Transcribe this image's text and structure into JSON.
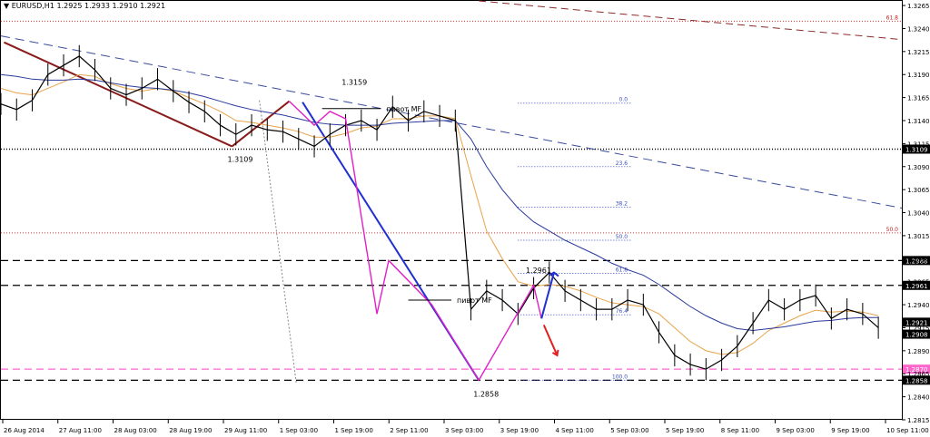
{
  "header": {
    "symbol_title": "EURUSD,H1",
    "ohlc": "1.2925 1.2933 1.2910 1.2921"
  },
  "chart_data": {
    "type": "line",
    "title": "EURUSD,H1 1.2925 1.2933 1.2910 1.2921",
    "xlabel": "",
    "ylabel": "",
    "ylim": [
      1.2815,
      1.327
    ],
    "y_ticks": [
      "1.3265",
      "1.3240",
      "1.3215",
      "1.3190",
      "1.3165",
      "1.3140",
      "1.3115",
      "1.3090",
      "1.3065",
      "1.3040",
      "1.3015",
      "1.2990",
      "1.2965",
      "1.2940",
      "1.2915",
      "1.2890",
      "1.2865",
      "1.2840",
      "1.2815"
    ],
    "x_tick_labels": [
      "26 Aug 2014",
      "27 Aug 11:00",
      "28 Aug 03:00",
      "28 Aug 19:00",
      "29 Aug 11:00",
      "1 Sep 03:00",
      "1 Sep 19:00",
      "2 Sep 11:00",
      "3 Sep 03:00",
      "3 Sep 19:00",
      "4 Sep 11:00",
      "5 Sep 03:00",
      "5 Sep 19:00",
      "8 Sep 11:00",
      "9 Sep 03:00",
      "9 Sep 19:00",
      "10 Sep 11:00"
    ],
    "x_range": [
      0,
      115
    ],
    "price": {
      "name": "",
      "x": [
        0,
        2,
        4,
        6,
        8,
        10,
        12,
        14,
        16,
        18,
        20,
        22,
        24,
        26,
        28,
        30,
        32,
        34,
        36,
        38,
        40,
        42,
        44,
        46,
        48,
        50,
        52,
        54,
        56,
        58,
        60,
        62,
        64,
        66,
        68,
        70,
        72,
        74,
        76,
        78,
        80,
        82,
        84,
        86,
        88,
        90,
        92,
        94,
        96,
        98,
        100,
        102,
        104,
        106,
        108,
        110,
        112
      ],
      "values": [
        1.3158,
        1.3152,
        1.3162,
        1.319,
        1.32,
        1.321,
        1.3195,
        1.3175,
        1.3168,
        1.3175,
        1.3185,
        1.3172,
        1.316,
        1.315,
        1.3135,
        1.3125,
        1.3135,
        1.313,
        1.3128,
        1.312,
        1.3112,
        1.3125,
        1.3135,
        1.314,
        1.313,
        1.3155,
        1.314,
        1.315,
        1.3145,
        1.314,
        1.2935,
        1.2955,
        1.2945,
        1.293,
        1.2958,
        1.2975,
        1.2955,
        1.2945,
        1.2935,
        1.2935,
        1.2945,
        1.294,
        1.291,
        1.2885,
        1.2875,
        1.287,
        1.288,
        1.2895,
        1.292,
        1.2945,
        1.2935,
        1.2945,
        1.295,
        1.2925,
        1.2935,
        1.293,
        1.2915
      ]
    },
    "moving_averages": [
      {
        "name": "",
        "color": "#e8a34a",
        "values": [
          1.3175,
          1.317,
          1.3168,
          1.3175,
          1.3182,
          1.319,
          1.3188,
          1.318,
          1.3175,
          1.3172,
          1.3175,
          1.3172,
          1.3165,
          1.3158,
          1.315,
          1.314,
          1.3138,
          1.3135,
          1.3132,
          1.3128,
          1.3122,
          1.3122,
          1.3126,
          1.3132,
          1.3134,
          1.3142,
          1.3142,
          1.3145,
          1.3145,
          1.3142,
          1.308,
          1.302,
          1.299,
          1.2965,
          1.296,
          1.2962,
          1.296,
          1.2955,
          1.2948,
          1.2942,
          1.294,
          1.2938,
          1.293,
          1.2915,
          1.29,
          1.289,
          1.2886,
          1.2888,
          1.2898,
          1.2912,
          1.292,
          1.2928,
          1.2934,
          1.2932,
          1.2933,
          1.2932,
          1.2928
        ]
      },
      {
        "name": "",
        "color": "#2a3a9c",
        "values": [
          1.319,
          1.3188,
          1.3185,
          1.3184,
          1.3184,
          1.3185,
          1.3184,
          1.3181,
          1.3178,
          1.3176,
          1.3175,
          1.3173,
          1.317,
          1.3166,
          1.3161,
          1.3156,
          1.3152,
          1.3149,
          1.3146,
          1.3142,
          1.3138,
          1.3136,
          1.3135,
          1.3135,
          1.3135,
          1.3137,
          1.3138,
          1.3139,
          1.314,
          1.314,
          1.312,
          1.309,
          1.3065,
          1.3045,
          1.303,
          1.302,
          1.301,
          1.3002,
          1.2994,
          1.2985,
          1.2978,
          1.2972,
          1.2962,
          1.295,
          1.2938,
          1.2928,
          1.292,
          1.2914,
          1.2912,
          1.2914,
          1.2916,
          1.2919,
          1.2922,
          1.2923,
          1.2925,
          1.2926,
          1.2926
        ]
      }
    ],
    "horizontal_levels": [
      {
        "name": "",
        "price": 1.3109,
        "style": "dotted",
        "color": "#000000",
        "label": "1.3109"
      },
      {
        "name": "",
        "price": 1.2988,
        "style": "dashed",
        "color": "#000000",
        "label": "1.2988"
      },
      {
        "name": "",
        "price": 1.2961,
        "style": "dashed",
        "color": "#000000",
        "label": "1.2961"
      },
      {
        "name": "",
        "price": 1.287,
        "style": "dashed",
        "color": "#ff66cc",
        "label": "1.2870"
      },
      {
        "name": "",
        "price": 1.2858,
        "style": "dashed",
        "color": "#000000",
        "label": "1.2858"
      }
    ],
    "fibonacci": [
      {
        "level": "0.0",
        "price": 1.3159
      },
      {
        "level": "23.6",
        "price": 1.309
      },
      {
        "level": "38.2",
        "price": 1.3046
      },
      {
        "level": "50.0",
        "price": 1.301
      },
      {
        "level": "61.8",
        "price": 1.2974
      },
      {
        "level": "76.4",
        "price": 1.2929
      },
      {
        "level": "100.0",
        "price": 1.2858
      }
    ],
    "red_levels": [
      {
        "level": "61.8",
        "price": 1.3248
      },
      {
        "level": "50.0",
        "price": 1.3018
      }
    ],
    "annotations": [
      {
        "text": "1.3159"
      },
      {
        "text": "1.3109"
      },
      {
        "text": "1.2961"
      },
      {
        "text": "1.2858"
      },
      {
        "text": "пивот MF"
      },
      {
        "text": "пивот MF"
      }
    ],
    "price_labels": [
      {
        "text": "1.2921",
        "price": 1.2921
      },
      {
        "text": "1.2908",
        "price": 1.2908
      }
    ],
    "grid": false,
    "legend": "none"
  }
}
